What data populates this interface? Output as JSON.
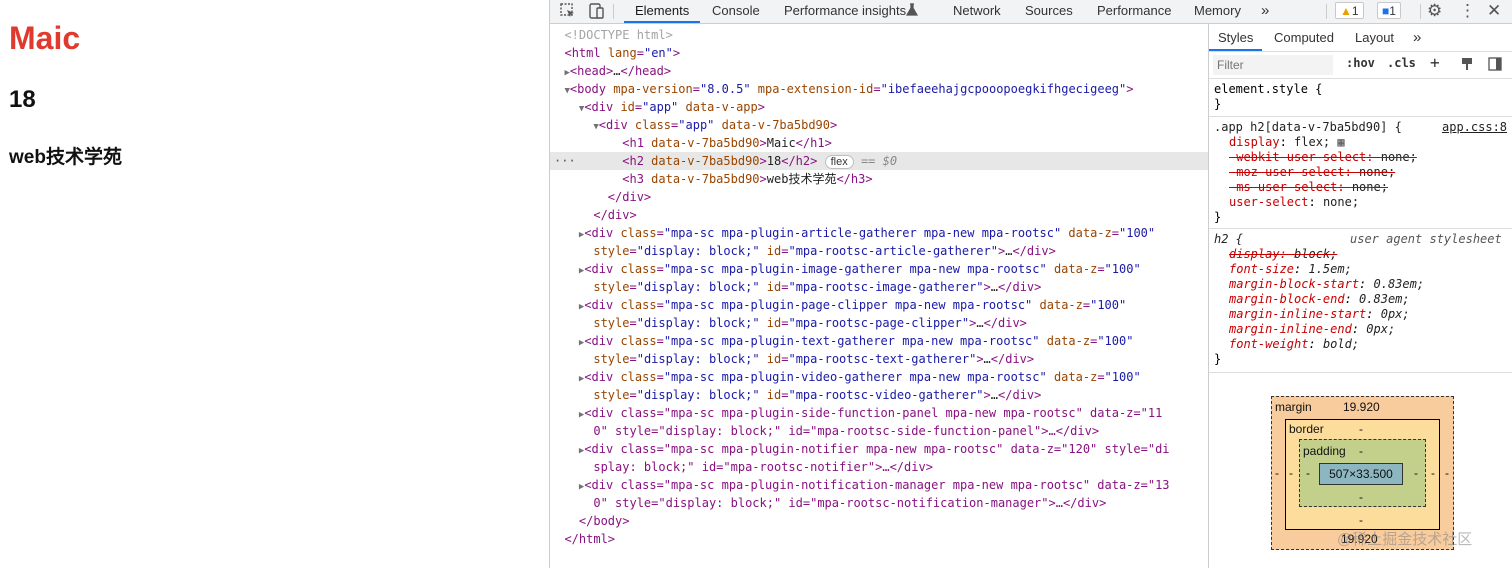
{
  "page": {
    "h1": "Maic",
    "h2": "18",
    "h3": "web技术学苑"
  },
  "toolbar": {
    "tabs": [
      "Elements",
      "Console",
      "Performance insights",
      "Network",
      "Sources",
      "Performance",
      "Memory"
    ],
    "more": "»",
    "warnings_count": "1",
    "messages_count": "1"
  },
  "dom": {
    "doctype": "<!DOCTYPE html>",
    "lines": {
      "html_open_tag": "html",
      "html_attr": "lang",
      "html_val": "\"en\"",
      "head": "head",
      "head_ellipsis": "…",
      "body": "body",
      "body_attr1": "mpa-version",
      "body_val1": "\"8.0.5\"",
      "body_attr2": "mpa-extension-id",
      "body_val2": "\"ibefaeehajgcpooopoegkifhgecigeeg\"",
      "div_app_id": "\"app\"",
      "div_app_attr": "data-v-app",
      "div_app_class": "\"app\"",
      "scoped_attr": "data-v-7ba5bd90",
      "h1_text": "Maic",
      "h2_text": "18",
      "h3_text": "web技术学苑",
      "flex_badge": "flex",
      "eq_marker": "== $0"
    },
    "plugins": [
      {
        "cls": "\"mpa-sc mpa-plugin-article-gatherer mpa-new mpa-rootsc\"",
        "z": "\"100\"",
        "line2_prefix": "style=",
        "style": "\"display: block;\"",
        "id": "\"mpa-rootsc-article-gatherer\""
      },
      {
        "cls": "\"mpa-sc mpa-plugin-image-gatherer mpa-new mpa-rootsc\"",
        "z": "\"100\"",
        "line2_prefix": "style=",
        "style": "\"display: block;\"",
        "id": "\"mpa-rootsc-image-gatherer\""
      },
      {
        "cls": "\"mpa-sc mpa-plugin-page-clipper mpa-new mpa-rootsc\"",
        "z": "\"100\"",
        "line2_prefix": "style=",
        "style": "\"display: block;\"",
        "id": "\"mpa-rootsc-page-clipper\""
      },
      {
        "cls": "\"mpa-sc mpa-plugin-text-gatherer mpa-new mpa-rootsc\"",
        "z": "\"100\"",
        "line2_prefix": "style=",
        "style": "\"display: block;\"",
        "id": "\"mpa-rootsc-text-gatherer\""
      },
      {
        "cls": "\"mpa-sc mpa-plugin-video-gatherer mpa-new mpa-rootsc\"",
        "z": "\"100\"",
        "line2_prefix": "style=",
        "style": "\"display: block;\"",
        "id": "\"mpa-rootsc-video-gatherer\""
      }
    ],
    "wrapped": [
      {
        "line1": "<div class=\"mpa-sc mpa-plugin-side-function-panel mpa-new mpa-rootsc\" data-z=\"11",
        "line2": "0\" style=\"display: block;\" id=\"mpa-rootsc-side-function-panel\">…</div>"
      },
      {
        "line1": "<div class=\"mpa-sc mpa-plugin-notifier mpa-new mpa-rootsc\" data-z=\"120\" style=\"di",
        "line2": "splay: block;\" id=\"mpa-rootsc-notifier\">…</div>"
      },
      {
        "line1": "<div class=\"mpa-sc mpa-plugin-notification-manager mpa-new mpa-rootsc\" data-z=\"13",
        "line2": "0\" style=\"display: block;\" id=\"mpa-rootsc-notification-manager\">…</div>"
      }
    ],
    "close_div": "</div>",
    "close_body": "</body>",
    "close_html": "</html>"
  },
  "styles": {
    "tabs": [
      "Styles",
      "Computed",
      "Layout"
    ],
    "more": "»",
    "filter_placeholder": "Filter",
    "hov": ":hov",
    "cls": ".cls",
    "plus": "+",
    "element_style": "element.style {",
    "close_brace": "}",
    "rule1_selector": ".app h2[data-v-7ba5bd90] {",
    "rule1_source": "app.css:8",
    "rule1_props": [
      {
        "name": "display",
        "value": "flex;",
        "struck": false
      },
      {
        "name": "-webkit-user-select",
        "value": "none;",
        "struck": true
      },
      {
        "name": "-moz-user-select",
        "value": "none;",
        "struck": true
      },
      {
        "name": "-ms-user-select",
        "value": "none;",
        "struck": true
      },
      {
        "name": "user-select",
        "value": "none;",
        "struck": false
      }
    ],
    "rule2_selector": "h2 {",
    "rule2_source": "user agent stylesheet",
    "rule2_props": [
      {
        "name": "display",
        "value": "block;",
        "struck": true
      },
      {
        "name": "font-size",
        "value": "1.5em;",
        "struck": false
      },
      {
        "name": "margin-block-start",
        "value": "0.83em;",
        "struck": false
      },
      {
        "name": "margin-block-end",
        "value": "0.83em;",
        "struck": false
      },
      {
        "name": "margin-inline-start",
        "value": "0px;",
        "struck": false
      },
      {
        "name": "margin-inline-end",
        "value": "0px;",
        "struck": false
      },
      {
        "name": "font-weight",
        "value": "bold;",
        "struck": false
      }
    ]
  },
  "boxmodel": {
    "margin_label": "margin",
    "margin_top": "19.920",
    "margin_bottom": "19.920",
    "margin_left": "-",
    "margin_right": "-",
    "border_label": "border",
    "border_top": "-",
    "border_bottom": "-",
    "border_left": "-",
    "border_right": "-",
    "padding_label": "padding",
    "padding_top": "-",
    "padding_bottom": "-",
    "padding_left": "-",
    "padding_right": "-",
    "content": "507×33.500"
  },
  "watermark": "@稀土掘金技术社区",
  "colors": {
    "h1": "#e03a2f",
    "tag": "#881280",
    "attr_name": "#994500",
    "attr_value": "#1a1aa6",
    "prop_name": "#c80000",
    "accent": "#1a73e8",
    "bm_margin": "#f9cc9d",
    "bm_border": "#fddd9b",
    "bm_padding": "#c3d08b",
    "bm_content": "#8cb6c0"
  }
}
